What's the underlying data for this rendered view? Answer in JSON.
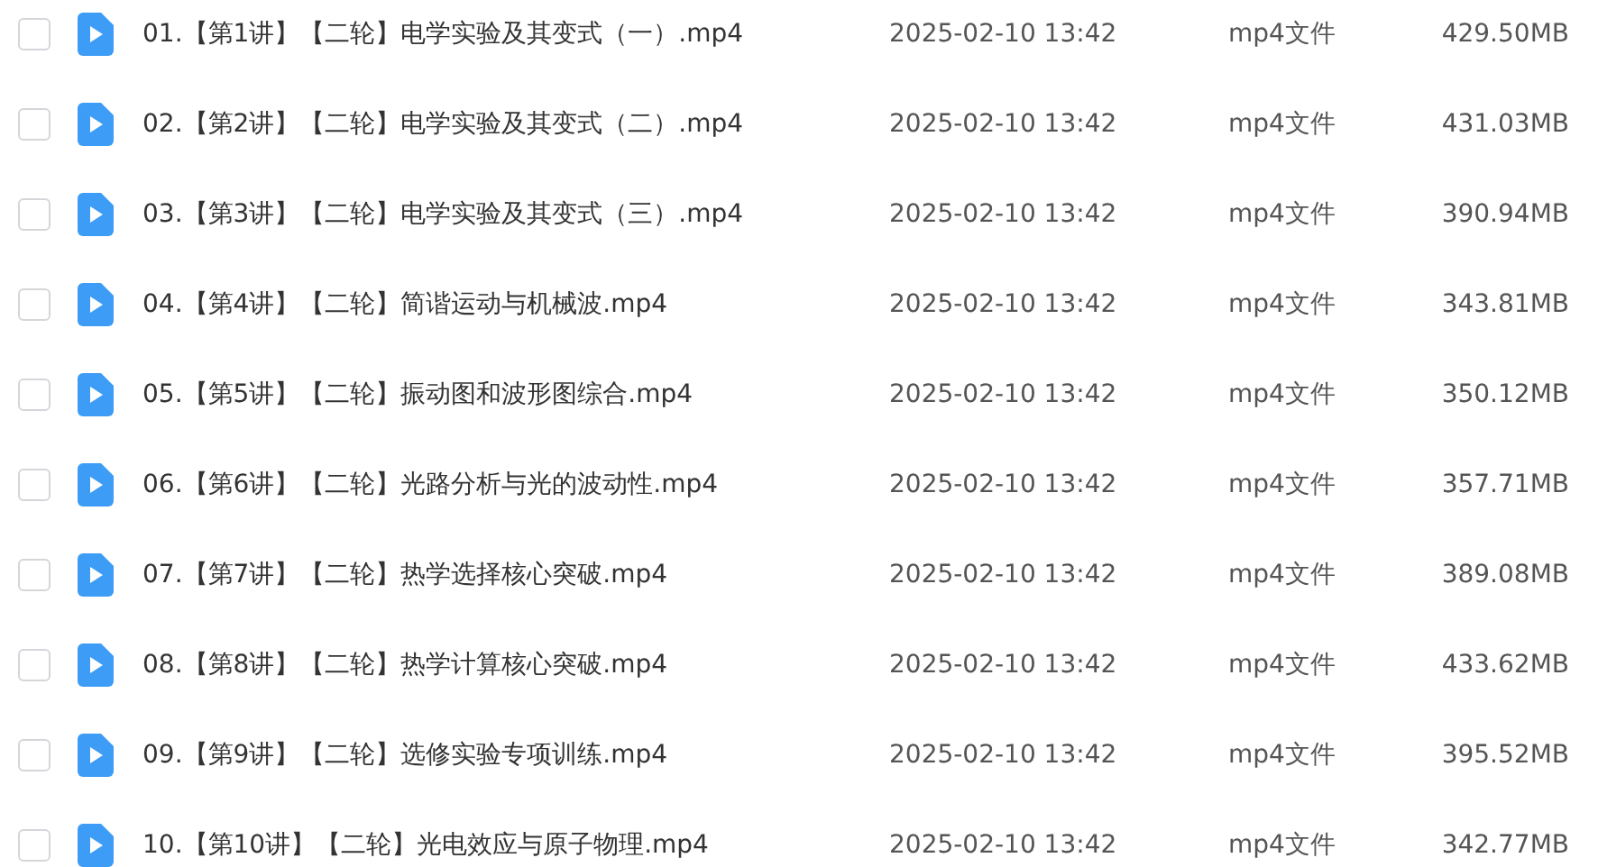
{
  "files": [
    {
      "name": "01.【第1讲】【二轮】电学实验及其变式（一）.mp4",
      "date": "2025-02-10 13:42",
      "type": "mp4文件",
      "size": "429.50MB",
      "checked": false
    },
    {
      "name": "02.【第2讲】【二轮】电学实验及其变式（二）.mp4",
      "date": "2025-02-10 13:42",
      "type": "mp4文件",
      "size": "431.03MB",
      "checked": false
    },
    {
      "name": "03.【第3讲】【二轮】电学实验及其变式（三）.mp4",
      "date": "2025-02-10 13:42",
      "type": "mp4文件",
      "size": "390.94MB",
      "checked": false
    },
    {
      "name": "04.【第4讲】【二轮】简谐运动与机械波.mp4",
      "date": "2025-02-10 13:42",
      "type": "mp4文件",
      "size": "343.81MB",
      "checked": false
    },
    {
      "name": "05.【第5讲】【二轮】振动图和波形图综合.mp4",
      "date": "2025-02-10 13:42",
      "type": "mp4文件",
      "size": "350.12MB",
      "checked": false
    },
    {
      "name": "06.【第6讲】【二轮】光路分析与光的波动性.mp4",
      "date": "2025-02-10 13:42",
      "type": "mp4文件",
      "size": "357.71MB",
      "checked": false
    },
    {
      "name": "07.【第7讲】【二轮】热学选择核心突破.mp4",
      "date": "2025-02-10 13:42",
      "type": "mp4文件",
      "size": "389.08MB",
      "checked": false
    },
    {
      "name": "08.【第8讲】【二轮】热学计算核心突破.mp4",
      "date": "2025-02-10 13:42",
      "type": "mp4文件",
      "size": "433.62MB",
      "checked": false
    },
    {
      "name": "09.【第9讲】【二轮】选修实验专项训练.mp4",
      "date": "2025-02-10 13:42",
      "type": "mp4文件",
      "size": "395.52MB",
      "checked": false
    },
    {
      "name": "10.【第10讲】【二轮】光电效应与原子物理.mp4",
      "date": "2025-02-10 13:42",
      "type": "mp4文件",
      "size": "342.77MB",
      "checked": false
    }
  ]
}
